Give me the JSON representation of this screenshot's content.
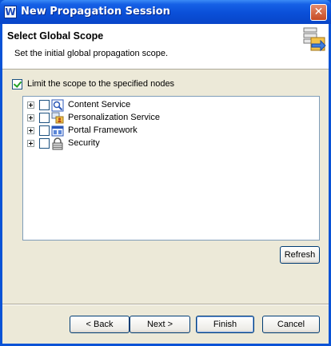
{
  "window": {
    "title": "New Propagation Session",
    "app_icon": "W"
  },
  "banner": {
    "title": "Select Global Scope",
    "description": "Set the initial global propagation scope."
  },
  "limit_scope": {
    "label": "Limit the scope to the specified nodes",
    "checked": true
  },
  "tree": {
    "items": [
      {
        "label": "Content Service",
        "icon": "content-service-icon",
        "checked": false
      },
      {
        "label": "Personalization Service",
        "icon": "personalization-service-icon",
        "checked": false
      },
      {
        "label": "Portal Framework",
        "icon": "portal-framework-icon",
        "checked": false
      },
      {
        "label": "Security",
        "icon": "security-lock-icon",
        "checked": false
      }
    ]
  },
  "buttons": {
    "refresh": "Refresh",
    "back": "< Back",
    "next": "Next >",
    "finish": "Finish",
    "cancel": "Cancel"
  },
  "colors": {
    "titlebar": "#0a4fd8",
    "dialog_bg": "#ece9d8",
    "button_border": "#003c74",
    "close_button": "#c64a24"
  }
}
